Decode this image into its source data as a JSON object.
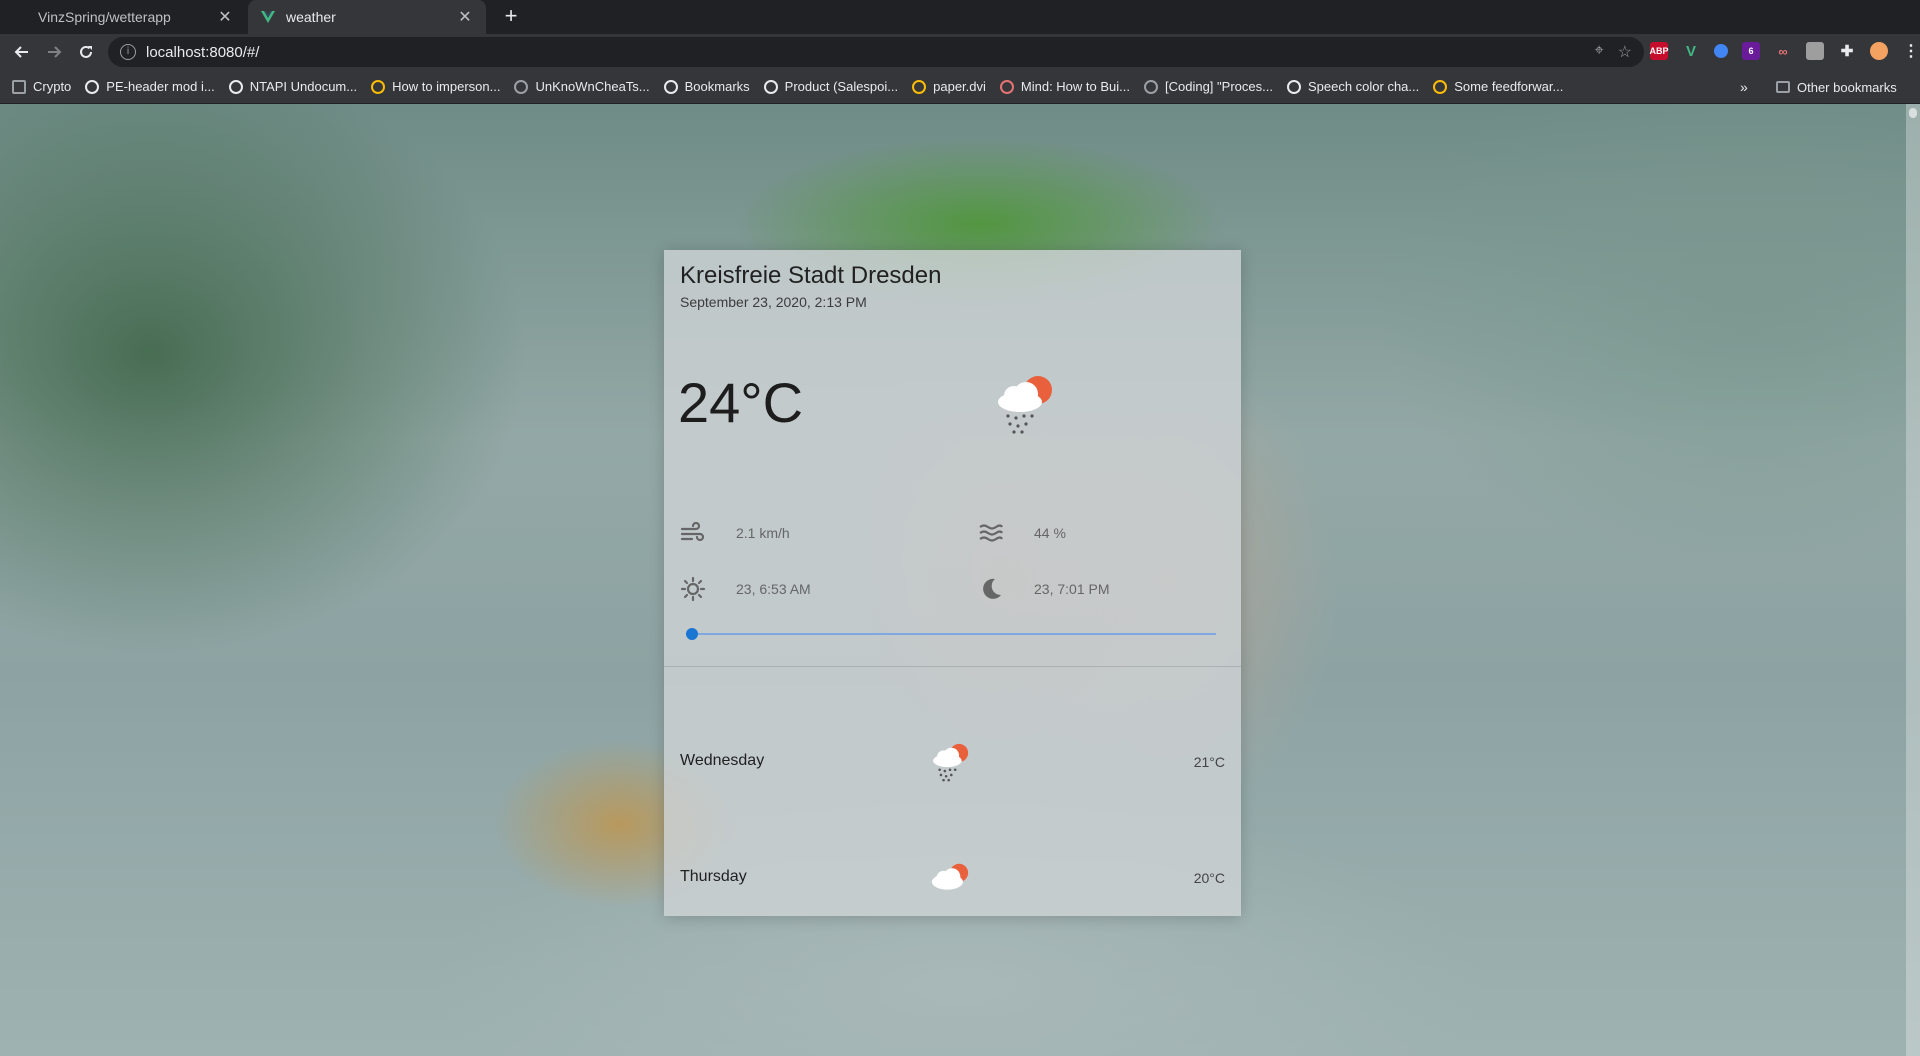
{
  "browser": {
    "tabs": [
      {
        "title": "VinzSpring/wetterapp",
        "active": false
      },
      {
        "title": "weather",
        "active": true
      }
    ],
    "url": "localhost:8080/#/",
    "bookmarks": [
      "Crypto",
      "PE-header mod i...",
      "NTAPI Undocum...",
      "How to imperson...",
      "UnKnoWnCheaTs...",
      "Bookmarks",
      "Product (Salespoi...",
      "paper.dvi",
      "Mind: How to Bui...",
      "[Coding] \"Proces...",
      "Speech color cha...",
      "Some feedforwar..."
    ],
    "more_label": "»",
    "other_bookmarks": "Other bookmarks",
    "extensions": [
      {
        "name": "abp-icon",
        "label": "ABP",
        "color": "#c70d2c"
      },
      {
        "name": "vue-icon",
        "label": "V",
        "color": "#41b883"
      },
      {
        "name": "ext-circle-icon",
        "label": "",
        "color": "#4285f4"
      },
      {
        "name": "ext-badge-icon",
        "label": "6",
        "color": "#6a1b9a"
      },
      {
        "name": "ext-glasses-icon",
        "label": "",
        "color": "#c2185b"
      },
      {
        "name": "ext-square-icon",
        "label": "",
        "color": "#757575"
      }
    ]
  },
  "weather": {
    "city": "Kreisfreie Stadt Dresden",
    "datetime": "September 23, 2020, 2:13 PM",
    "temperature": "24°C",
    "icon": "rain-cloud-sun-icon",
    "wind": "2.1 km/h",
    "humidity": "44 %",
    "sunrise": "23, 6:53 AM",
    "sunset": "23, 7:01 PM",
    "slider_value": 0,
    "forecast": [
      {
        "day": "Wednesday",
        "temp": "21°C",
        "icon": "rain-cloud-sun-icon"
      },
      {
        "day": "Thursday",
        "temp": "20°C",
        "icon": "cloud-sun-icon"
      }
    ]
  },
  "colors": {
    "accent": "#1976d2",
    "sun": "#e8603c"
  }
}
